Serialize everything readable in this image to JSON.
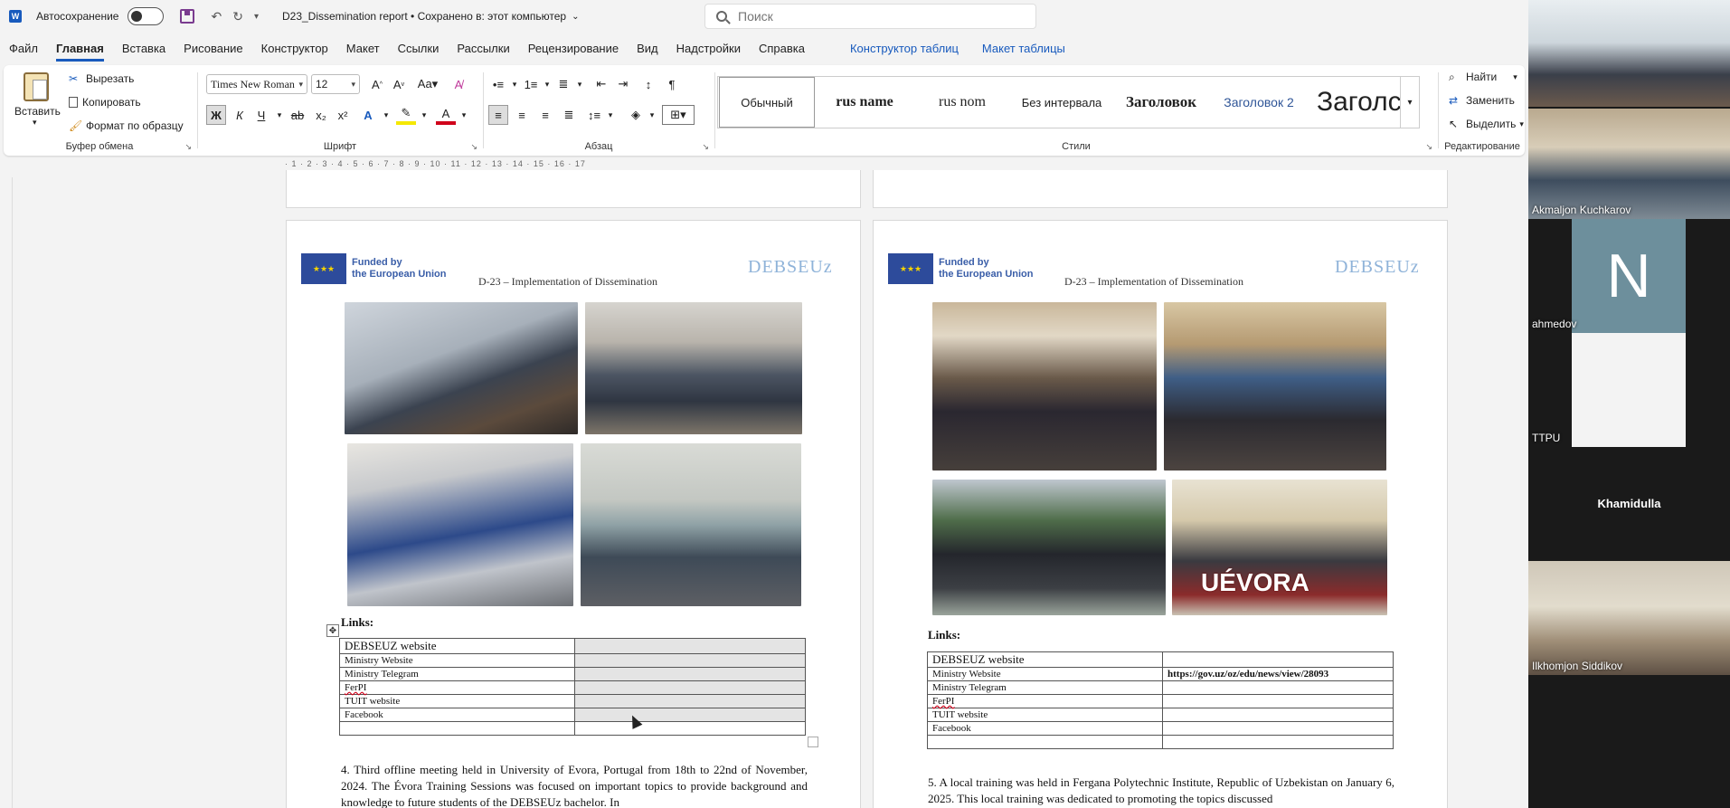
{
  "titlebar": {
    "autosave_label": "Автосохранение",
    "doc_title": "D23_Dissemination report • Сохранено в: этот компьютер",
    "search_placeholder": "Поиск"
  },
  "menu": [
    {
      "label": "Файл"
    },
    {
      "label": "Главная",
      "active": true
    },
    {
      "label": "Вставка"
    },
    {
      "label": "Рисование"
    },
    {
      "label": "Конструктор"
    },
    {
      "label": "Макет"
    },
    {
      "label": "Ссылки"
    },
    {
      "label": "Рассылки"
    },
    {
      "label": "Рецензирование"
    },
    {
      "label": "Вид"
    },
    {
      "label": "Надстройки"
    },
    {
      "label": "Справка"
    },
    {
      "label": "Конструктор таблиц",
      "blue": true
    },
    {
      "label": "Макет таблицы",
      "blue": true
    }
  ],
  "ribbon": {
    "clipboard": {
      "paste": "Вставить",
      "cut": "Вырезать",
      "copy": "Копировать",
      "format_painter": "Формат по образцу",
      "group_label": "Буфер обмена"
    },
    "font": {
      "font_name": "Times New Roman",
      "font_size": "12",
      "bold": "Ж",
      "italic": "К",
      "underline": "Ч",
      "strike": "ab",
      "group_label": "Шрифт"
    },
    "paragraph": {
      "group_label": "Абзац"
    },
    "styles": {
      "items": [
        "Обычный",
        "rus name",
        "rus nom",
        "Без интервала",
        "Заголовок",
        "Заголовок 2",
        "Заголс"
      ],
      "group_label": "Стили"
    },
    "editing": {
      "find": "Найти",
      "replace": "Заменить",
      "select": "Выделить",
      "group_label": "Редактирование"
    }
  },
  "ruler_text": "· 1 · 2 · 3 · 4 · 5 · 6 · 7 · 8 · 9 · 10 · 11 · 12 · 13 · 14 · 15 · 16 · 17",
  "page_header": {
    "eu_line1": "Funded by",
    "eu_line2": "the European Union",
    "title": "D-23 – Implementation of Dissemination",
    "logo": "DEBSEUz"
  },
  "left_page": {
    "links_label": "Links:",
    "rows": [
      {
        "name": "DEBSEUZ website",
        "url": ""
      },
      {
        "name": "Ministry Website",
        "url": ""
      },
      {
        "name": "Ministry Telegram",
        "url": ""
      },
      {
        "name": "FerPI",
        "url": ""
      },
      {
        "name": "TUIT website",
        "url": ""
      },
      {
        "name": "Facebook",
        "url": ""
      },
      {
        "name": "",
        "url": ""
      }
    ],
    "paragraph": "4. Third offline meeting held in University of Evora, Portugal from 18th to 22nd of November, 2024. The Évora Training Sessions was focused on important topics to provide background and knowledge to future students of the DEBSEUz bachelor. In"
  },
  "right_page": {
    "links_label": "Links:",
    "rows": [
      {
        "name": "DEBSEUZ website",
        "url": ""
      },
      {
        "name": "Ministry Website",
        "url": "https://gov.uz/oz/edu/news/view/28093"
      },
      {
        "name": "Ministry Telegram",
        "url": ""
      },
      {
        "name": "FerPI",
        "url": ""
      },
      {
        "name": "TUIT website",
        "url": ""
      },
      {
        "name": "Facebook",
        "url": ""
      },
      {
        "name": "",
        "url": ""
      }
    ],
    "photo_sign": "UÉVORA",
    "paragraph": "5. A local training was held in Fergana Polytechnic Institute, Republic of Uzbekistan on January 6, 2025. This local training was dedicated to promoting the topics discussed"
  },
  "participants": [
    {
      "name": ""
    },
    {
      "name": "Akmaljon Kuchkarov"
    },
    {
      "name": "ahmedov",
      "initial": "N"
    },
    {
      "name": "TTPU"
    },
    {
      "name": "Khamidulla"
    },
    {
      "name": "Ilkhomjon Siddikov"
    }
  ]
}
